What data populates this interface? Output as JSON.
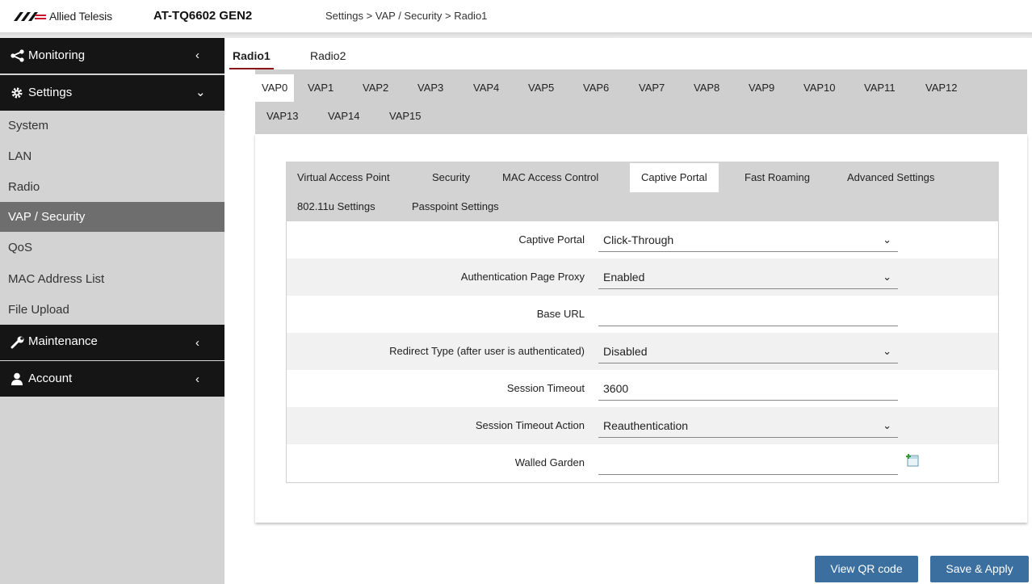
{
  "header": {
    "logo_text": "Allied Telesis",
    "product": "AT-TQ6602 GEN2",
    "breadcrumb": "Settings > VAP / Security > Radio1"
  },
  "sidebar": {
    "monitoring": "Monitoring",
    "settings": "Settings",
    "items": [
      "System",
      "LAN",
      "Radio",
      "VAP / Security",
      "QoS",
      "MAC Address List",
      "File Upload"
    ],
    "active_item": "VAP / Security",
    "maintenance": "Maintenance",
    "account": "Account"
  },
  "radio_tabs": [
    "Radio1",
    "Radio2"
  ],
  "vap_tabs": [
    "VAP0",
    "VAP1",
    "VAP2",
    "VAP3",
    "VAP4",
    "VAP5",
    "VAP6",
    "VAP7",
    "VAP8",
    "VAP9",
    "VAP10",
    "VAP11",
    "VAP12",
    "VAP13",
    "VAP14",
    "VAP15"
  ],
  "sub_tabs": [
    "Virtual Access Point",
    "Security",
    "MAC Access Control",
    "Captive Portal",
    "Fast Roaming",
    "Advanced Settings",
    "802.11u Settings",
    "Passpoint Settings"
  ],
  "form": {
    "captive_portal": {
      "label": "Captive Portal",
      "value": "Click-Through"
    },
    "auth_page_proxy": {
      "label": "Authentication Page Proxy",
      "value": "Enabled"
    },
    "base_url": {
      "label": "Base URL",
      "value": ""
    },
    "redirect_type": {
      "label": "Redirect Type (after user is authenticated)",
      "value": "Disabled"
    },
    "session_timeout": {
      "label": "Session Timeout",
      "value": "3600"
    },
    "session_timeout_action": {
      "label": "Session Timeout Action",
      "value": "Reauthentication"
    },
    "walled_garden": {
      "label": "Walled Garden",
      "value": ""
    }
  },
  "buttons": {
    "view_qr": "View QR code",
    "save_apply": "Save & Apply"
  },
  "colors": {
    "sidebar_dark": "#151515",
    "sidebar_bg": "#d3d3d3",
    "active_item": "#6e6e6e",
    "button": "#3b6fa0",
    "radio_underline": "#8c1416"
  }
}
